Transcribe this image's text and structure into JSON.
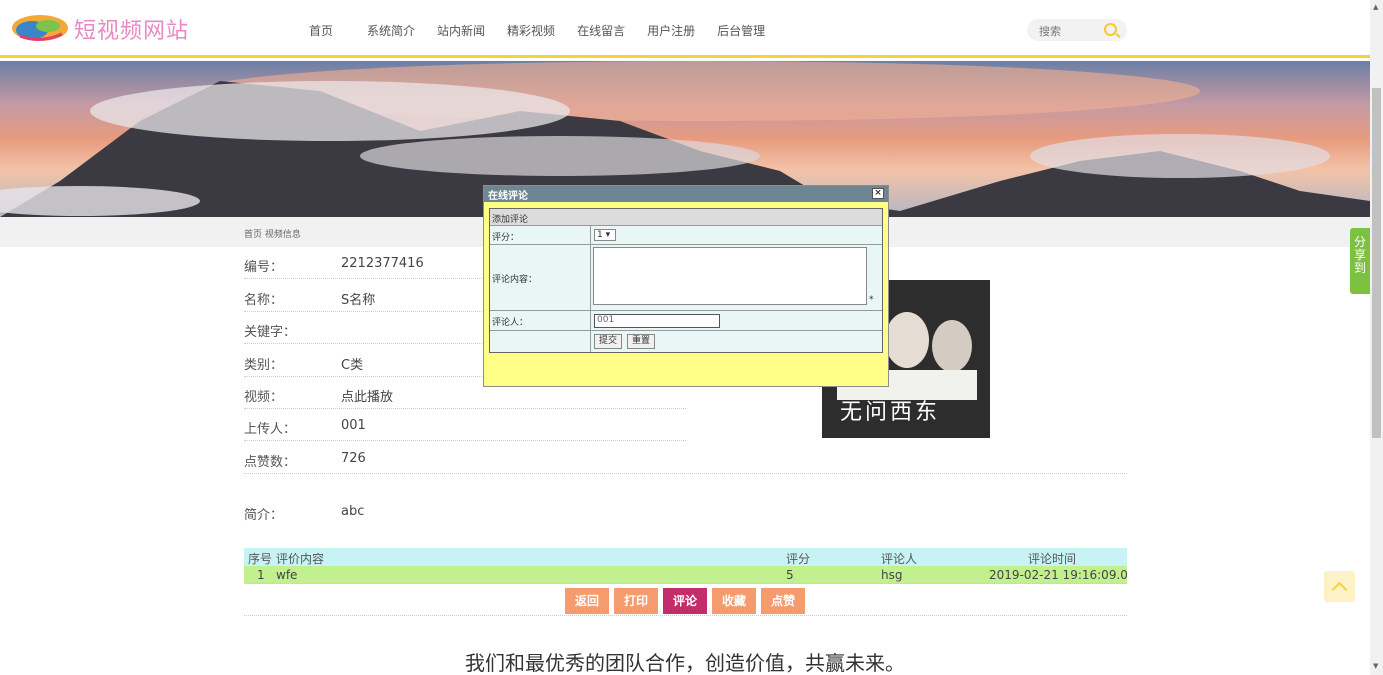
{
  "header": {
    "site_name": "短视频网站",
    "nav": [
      "首页",
      "系统简介",
      "站内新闻",
      "精彩视频",
      "在线留言",
      "用户注册",
      "后台管理"
    ],
    "search_placeholder": "搜索"
  },
  "breadcrumb": "首页 视频信息",
  "details": [
    {
      "label": "编号：",
      "value": "2212377416"
    },
    {
      "label": "名称：",
      "value": "S名称"
    },
    {
      "label": "关键字：",
      "value": ""
    },
    {
      "label": "类别：",
      "value": "C类"
    },
    {
      "label": "视频：",
      "value": "点此播放"
    },
    {
      "label": "上传人：",
      "value": "001"
    },
    {
      "label": "点赞数：",
      "value": "726"
    }
  ],
  "intro": {
    "label": "简介：",
    "value": "abc"
  },
  "poster_title": "无问西东",
  "comments": {
    "headers": [
      "序号",
      "评价内容",
      "评分",
      "评论人",
      "评论时间"
    ],
    "rows": [
      {
        "no": "1",
        "content": "wfe",
        "score": "5",
        "user": "hsg",
        "time": "2019-02-21 19:16:09.0"
      }
    ]
  },
  "buttons": [
    "返回",
    "打印",
    "评论",
    "收藏",
    "点赞"
  ],
  "slogan": "我们和最优秀的团队合作，创造价值，共赢未来。",
  "share_label": "分享到",
  "dialog": {
    "title": "在线评论",
    "close": "×",
    "section": "添加评论",
    "score_label": "评分：",
    "score_value": "1",
    "content_label": "评论内容：",
    "required_mark": "*",
    "user_label": "评论人：",
    "user_value": "001",
    "submit": "提交",
    "reset": "重置"
  }
}
